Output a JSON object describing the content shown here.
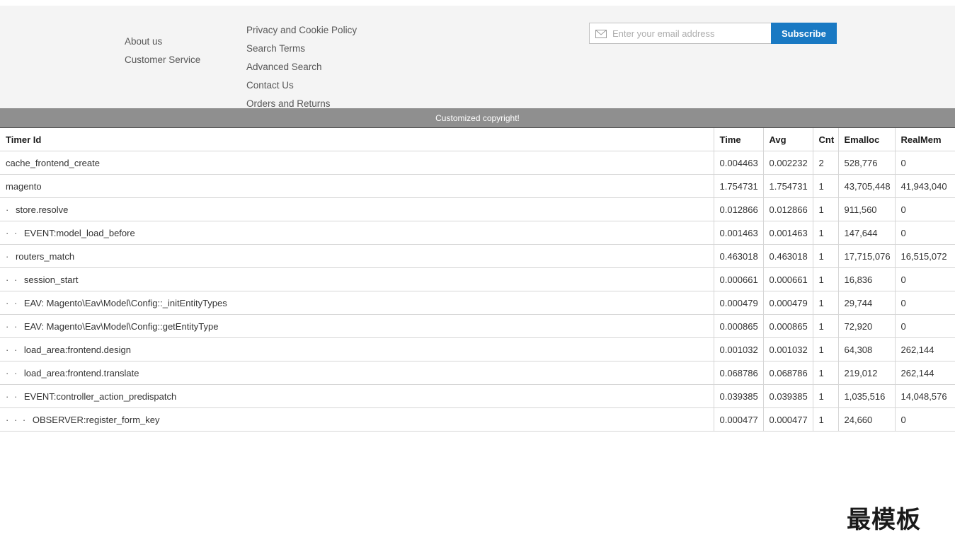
{
  "footer": {
    "columns": [
      {
        "links": [
          {
            "label": "About us"
          },
          {
            "label": "Customer Service"
          }
        ]
      },
      {
        "links": [
          {
            "label": "Privacy and Cookie Policy"
          },
          {
            "label": "Search Terms"
          },
          {
            "label": "Advanced Search"
          },
          {
            "label": "Contact Us"
          },
          {
            "label": "Orders and Returns"
          }
        ]
      }
    ],
    "newsletter": {
      "icon": "envelope-icon",
      "email_value": "",
      "email_placeholder": "Enter your email address",
      "subscribe_label": "Subscribe",
      "button_color": "#1979c3"
    },
    "copyright": {
      "text": "Customized copyright!",
      "background": "#8f8f8f",
      "text_color": "#ffffff"
    }
  },
  "profiler": {
    "columns": [
      "Timer Id",
      "Time",
      "Avg",
      "Cnt",
      "Emalloc",
      "RealMem"
    ],
    "rows": [
      {
        "depth": 0,
        "timer_id": "cache_frontend_create",
        "time": "0.004463",
        "avg": "0.002232",
        "cnt": "2",
        "emalloc": "528,776",
        "realmem": "0"
      },
      {
        "depth": 0,
        "timer_id": "magento",
        "time": "1.754731",
        "avg": "1.754731",
        "cnt": "1",
        "emalloc": "43,705,448",
        "realmem": "41,943,040"
      },
      {
        "depth": 1,
        "timer_id": "store.resolve",
        "time": "0.012866",
        "avg": "0.012866",
        "cnt": "1",
        "emalloc": "911,560",
        "realmem": "0"
      },
      {
        "depth": 2,
        "timer_id": "EVENT:model_load_before",
        "time": "0.001463",
        "avg": "0.001463",
        "cnt": "1",
        "emalloc": "147,644",
        "realmem": "0"
      },
      {
        "depth": 1,
        "timer_id": "routers_match",
        "time": "0.463018",
        "avg": "0.463018",
        "cnt": "1",
        "emalloc": "17,715,076",
        "realmem": "16,515,072"
      },
      {
        "depth": 2,
        "timer_id": "session_start",
        "time": "0.000661",
        "avg": "0.000661",
        "cnt": "1",
        "emalloc": "16,836",
        "realmem": "0"
      },
      {
        "depth": 2,
        "timer_id": "EAV: Magento\\Eav\\Model\\Config::_initEntityTypes",
        "time": "0.000479",
        "avg": "0.000479",
        "cnt": "1",
        "emalloc": "29,744",
        "realmem": "0"
      },
      {
        "depth": 2,
        "timer_id": "EAV: Magento\\Eav\\Model\\Config::getEntityType",
        "time": "0.000865",
        "avg": "0.000865",
        "cnt": "1",
        "emalloc": "72,920",
        "realmem": "0"
      },
      {
        "depth": 2,
        "timer_id": "load_area:frontend.design",
        "time": "0.001032",
        "avg": "0.001032",
        "cnt": "1",
        "emalloc": "64,308",
        "realmem": "262,144"
      },
      {
        "depth": 2,
        "timer_id": "load_area:frontend.translate",
        "time": "0.068786",
        "avg": "0.068786",
        "cnt": "1",
        "emalloc": "219,012",
        "realmem": "262,144"
      },
      {
        "depth": 2,
        "timer_id": "EVENT:controller_action_predispatch",
        "time": "0.039385",
        "avg": "0.039385",
        "cnt": "1",
        "emalloc": "1,035,516",
        "realmem": "14,048,576"
      },
      {
        "depth": 3,
        "timer_id": "OBSERVER:register_form_key",
        "time": "0.000477",
        "avg": "0.000477",
        "cnt": "1",
        "emalloc": "24,660",
        "realmem": "0"
      }
    ]
  },
  "watermark": {
    "title": "最模板",
    "url": "www.zuimoban.com"
  }
}
